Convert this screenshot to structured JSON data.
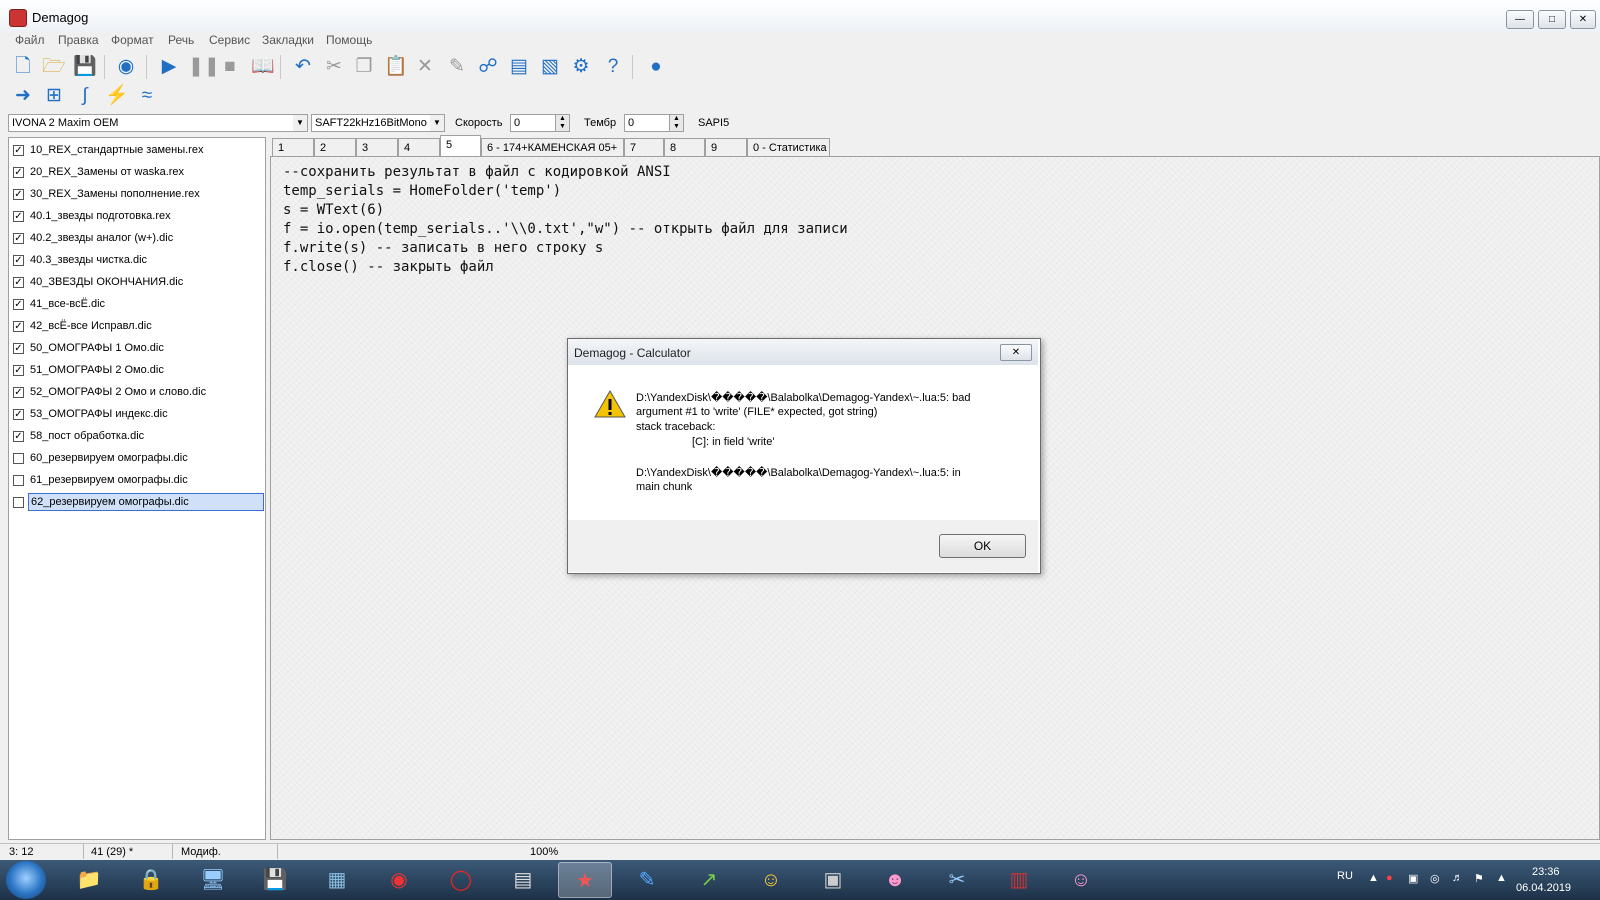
{
  "window": {
    "title": "Demagog"
  },
  "menu": [
    "Файл",
    "Правка",
    "Формат",
    "Речь",
    "Сервис",
    "Закладки",
    "Помощь"
  ],
  "toolbar1": [
    "new-file-icon",
    "open-folder-icon",
    "save-icon",
    "disc-icon",
    "play-icon",
    "pause-icon",
    "stop-icon",
    "book-icon",
    "undo-icon",
    "cut-icon",
    "copy-icon",
    "paste-icon",
    "delete-icon",
    "edit-icon",
    "binoculars-icon",
    "document-icon",
    "text-icon",
    "gear-icon",
    "help-icon",
    "globe-icon"
  ],
  "toolbar2": [
    "arrow-right-icon",
    "convert-icon",
    "integral-icon",
    "lightning-icon",
    "approx-icon"
  ],
  "settings": {
    "voice": "IVONA 2 Maxim OEM",
    "format": "SAFT22kHz16BitMono",
    "speed_label": "Скорость",
    "speed_value": "0",
    "timbre_label": "Тембр",
    "timbre_value": "0",
    "engine": "SAPI5"
  },
  "files": [
    {
      "name": "10_REX_стандартные замены.rex",
      "checked": true
    },
    {
      "name": "20_REX_Замены от waska.rex",
      "checked": true
    },
    {
      "name": "30_REX_Замены пополнение.rex",
      "checked": true
    },
    {
      "name": "40.1_звезды подготовка.rex",
      "checked": true
    },
    {
      "name": "40.2_звезды аналог (w+).dic",
      "checked": true
    },
    {
      "name": "40.3_звезды чистка.dic",
      "checked": true
    },
    {
      "name": "40_ЗВЕЗДЫ ОКОНЧАНИЯ.dic",
      "checked": true
    },
    {
      "name": "41_все-всЁ.dic",
      "checked": true
    },
    {
      "name": "42_всЁ-все Исправл.dic",
      "checked": true
    },
    {
      "name": "50_ОМОГРАФЫ 1 Омо.dic",
      "checked": true
    },
    {
      "name": "51_ОМОГРАФЫ 2 Омо.dic",
      "checked": true
    },
    {
      "name": "52_ОМОГРАФЫ 2 Омо и слово.dic",
      "checked": true
    },
    {
      "name": "53_ОМОГРАФЫ индекс.dic",
      "checked": true
    },
    {
      "name": "58_пост обработка.dic",
      "checked": true
    },
    {
      "name": "60_резервируем омографы.dic",
      "checked": false
    },
    {
      "name": "61_резервируем омографы.dic",
      "checked": false
    },
    {
      "name": "62_резервируем омографы.dic",
      "checked": false,
      "selected": true
    }
  ],
  "tabs": [
    "1",
    "2",
    "3",
    "4",
    "5",
    "6 - 174+КАМЕНСКАЯ 05+",
    "7",
    "8",
    "9",
    "0 - Статистика"
  ],
  "active_tab": "5",
  "code": [
    "--сохранить результат в файл с кодировкой ANSI",
    "temp_serials = HomeFolder('temp')",
    "s = WText(6)",
    "f = io.open(temp_serials..'\\\\0.txt',\"w\") -- открыть файл для записи",
    "f.write(s) -- записать в него строку s",
    "f.close() -- закрыть файл"
  ],
  "dialog": {
    "title": "Demagog - Calculator",
    "lines": [
      "D:\\YandexDisk\\�����\\Balabolka\\Demagog-Yandex\\~.lua:5: bad",
      "argument #1 to 'write' (FILE* expected, got string)",
      "stack traceback:",
      "[C]: in field 'write'",
      "",
      "D:\\YandexDisk\\�����\\Balabolka\\Demagog-Yandex\\~.lua:5: in",
      "main chunk"
    ],
    "ok_label": "OK"
  },
  "status": {
    "position": "3: 12",
    "count": "41 (29) *",
    "modified": "Модиф.",
    "zoom": "100%"
  },
  "taskbar": {
    "apps": [
      "explorer-icon",
      "lock-icon",
      "network-icon",
      "save-icon",
      "control-panel-icon",
      "chrome-icon",
      "opera-icon",
      "calculator-icon",
      "media-icon",
      "notepad-icon",
      "chart-icon",
      "smiley-icon",
      "monitor-icon",
      "anime-avatar-icon",
      "scissors-icon",
      "winrar-icon",
      "demagog-icon"
    ],
    "active_index": 8,
    "lang": "RU",
    "time": "23:36",
    "date": "06.04.2019"
  }
}
